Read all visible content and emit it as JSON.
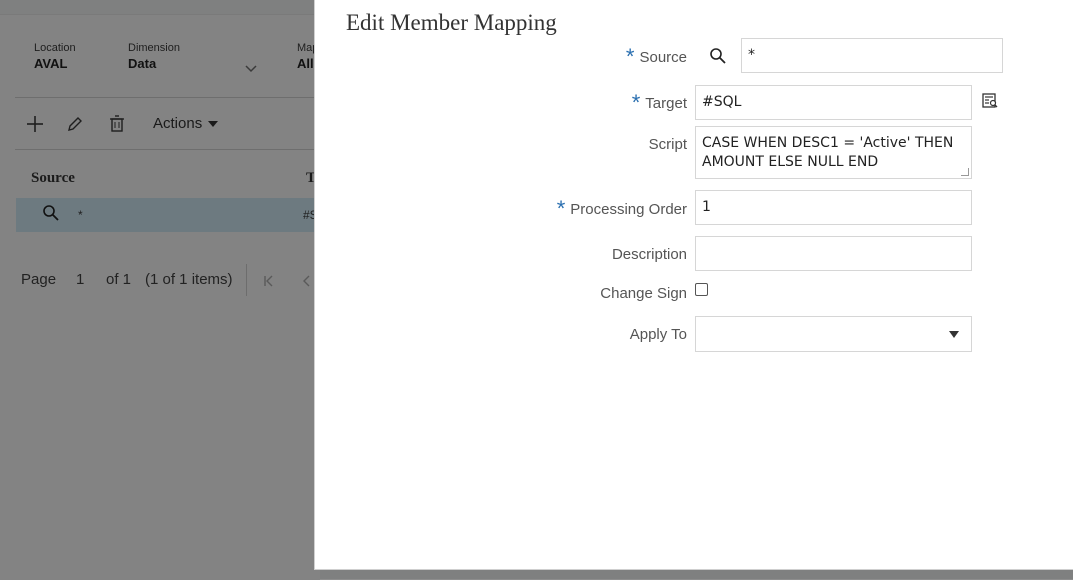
{
  "background": {
    "pov": [
      {
        "label": "Location",
        "value": "AVAL"
      },
      {
        "label": "Dimension",
        "value": "Data"
      },
      {
        "label": "Map",
        "value": "All"
      }
    ],
    "toolbar": {
      "actions_label": "Actions"
    },
    "table": {
      "headers": [
        "Source",
        "T"
      ],
      "rows": [
        {
          "source": "*",
          "target": "#S"
        }
      ]
    },
    "pager": {
      "page_label": "Page",
      "page_value": "1",
      "of_label": "of 1",
      "items_label": "(1 of 1 items)"
    }
  },
  "dialog": {
    "title": "Edit Member Mapping",
    "fields": {
      "source": {
        "label": "Source",
        "value": "*",
        "required": true
      },
      "target": {
        "label": "Target",
        "value": "#SQL",
        "required": true
      },
      "script": {
        "label": "Script",
        "value": "CASE WHEN DESC1 = 'Active' THEN AMOUNT ELSE NULL END"
      },
      "processing_order": {
        "label": "Processing Order",
        "value": "1",
        "required": true
      },
      "description": {
        "label": "Description",
        "value": ""
      },
      "change_sign": {
        "label": "Change Sign",
        "checked": false
      },
      "apply_to": {
        "label": "Apply To",
        "value": ""
      }
    },
    "required_marker": "*"
  },
  "colors": {
    "accent": "#2a6fb0",
    "dialog_bg": "#ffffff",
    "overlay": "#808080"
  }
}
